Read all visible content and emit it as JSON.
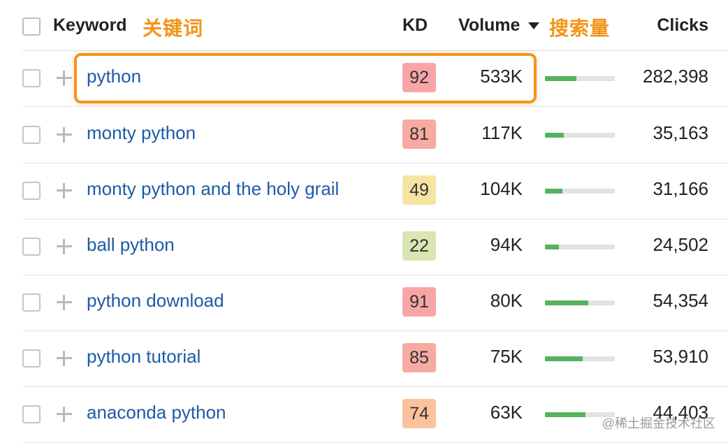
{
  "header": {
    "keyword_label": "Keyword",
    "keyword_cn": "关键词",
    "kd_label": "KD",
    "volume_label": "Volume",
    "volume_cn": "搜索量",
    "clicks_label": "Clicks",
    "sort_icon": "caret-down-icon"
  },
  "rows": [
    {
      "keyword": "python",
      "kd": "92",
      "kd_color": "#f8a5a8",
      "volume": "533K",
      "volume_bar": 0.45,
      "clicks": "282,398",
      "highlighted": true
    },
    {
      "keyword": "monty python",
      "kd": "81",
      "kd_color": "#f7aaa2",
      "volume": "117K",
      "volume_bar": 0.27,
      "clicks": "35,163"
    },
    {
      "keyword": "monty python and the holy grail",
      "kd": "49",
      "kd_color": "#f6e5a2",
      "volume": "104K",
      "volume_bar": 0.25,
      "clicks": "31,166"
    },
    {
      "keyword": "ball python",
      "kd": "22",
      "kd_color": "#d9e6b2",
      "volume": "94K",
      "volume_bar": 0.2,
      "clicks": "24,502"
    },
    {
      "keyword": "python download",
      "kd": "91",
      "kd_color": "#f8a5a8",
      "volume": "80K",
      "volume_bar": 0.62,
      "clicks": "54,354"
    },
    {
      "keyword": "python tutorial",
      "kd": "85",
      "kd_color": "#f7aaa2",
      "volume": "75K",
      "volume_bar": 0.54,
      "clicks": "53,910"
    },
    {
      "keyword": "anaconda python",
      "kd": "74",
      "kd_color": "#fbc39d",
      "volume": "63K",
      "volume_bar": 0.58,
      "clicks": "44,403"
    }
  ],
  "watermark": "@稀土掘金技术社区",
  "colors": {
    "accent_orange": "#f39419",
    "link_blue": "#1c5aa8",
    "bar_green": "#55b35e"
  }
}
